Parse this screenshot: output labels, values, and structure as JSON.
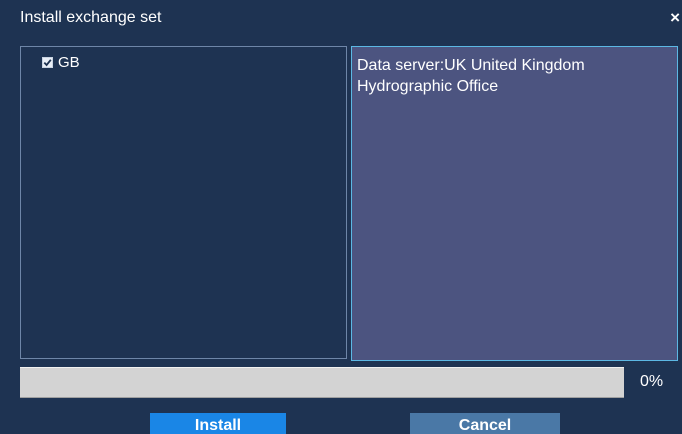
{
  "dialog": {
    "title": "Install exchange set",
    "close_glyph": "×"
  },
  "tree": {
    "items": [
      {
        "label": "GB",
        "checked": true
      }
    ]
  },
  "info": {
    "text": "Data server:UK United Kingdom Hydrographic Office"
  },
  "progress": {
    "value": 0,
    "label": "0%"
  },
  "buttons": {
    "install_label": "Install",
    "cancel_label": "Cancel"
  },
  "colors": {
    "background": "#1e3352",
    "info_panel": "#4c5480",
    "install_button": "#1a86e6",
    "cancel_button": "#4a78a6"
  }
}
